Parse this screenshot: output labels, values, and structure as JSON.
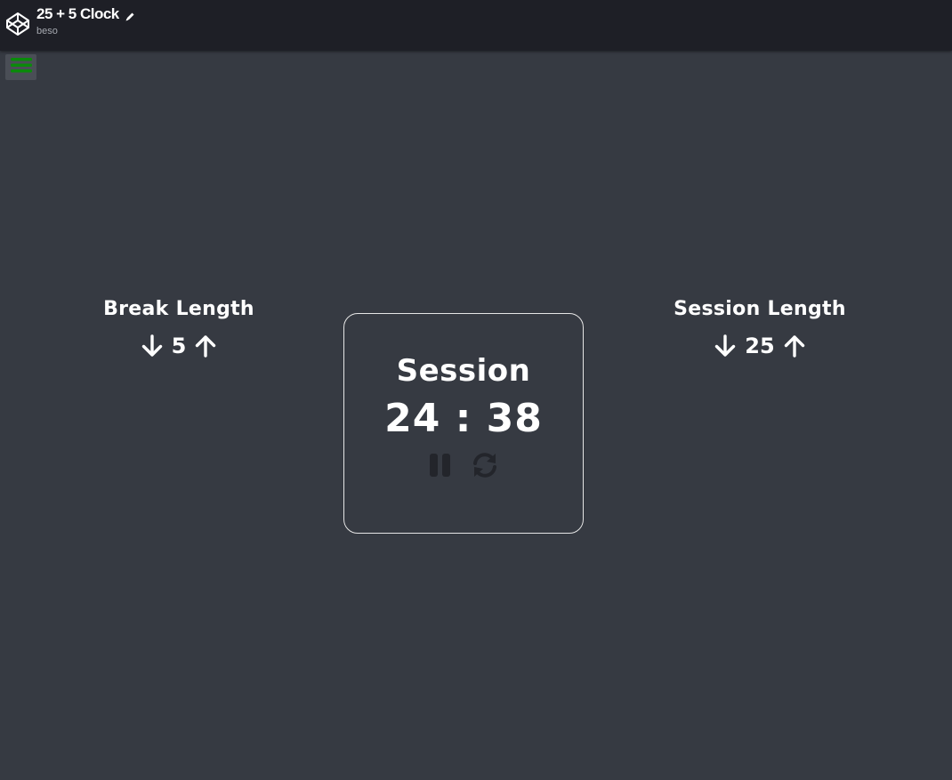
{
  "header": {
    "title": "25 + 5 Clock",
    "author": "beso",
    "logo_icon": "codepen-logo-icon",
    "edit_icon": "pencil-icon"
  },
  "menu": {
    "icon": "hamburger-menu-icon",
    "icon_color": "#0a8a0a"
  },
  "break": {
    "label": "Break Length",
    "value": "5",
    "decrement_icon": "arrow-down-icon",
    "increment_icon": "arrow-up-icon"
  },
  "session": {
    "label": "Session Length",
    "value": "25",
    "decrement_icon": "arrow-down-icon",
    "increment_icon": "arrow-up-icon"
  },
  "timer": {
    "label": "Session",
    "time": "24 : 38",
    "pause_icon": "pause-icon",
    "reset_icon": "refresh-icon",
    "control_color": "#23252b"
  },
  "colors": {
    "background": "#363a42",
    "topbar": "#1e1f26",
    "text": "#ffffff"
  }
}
